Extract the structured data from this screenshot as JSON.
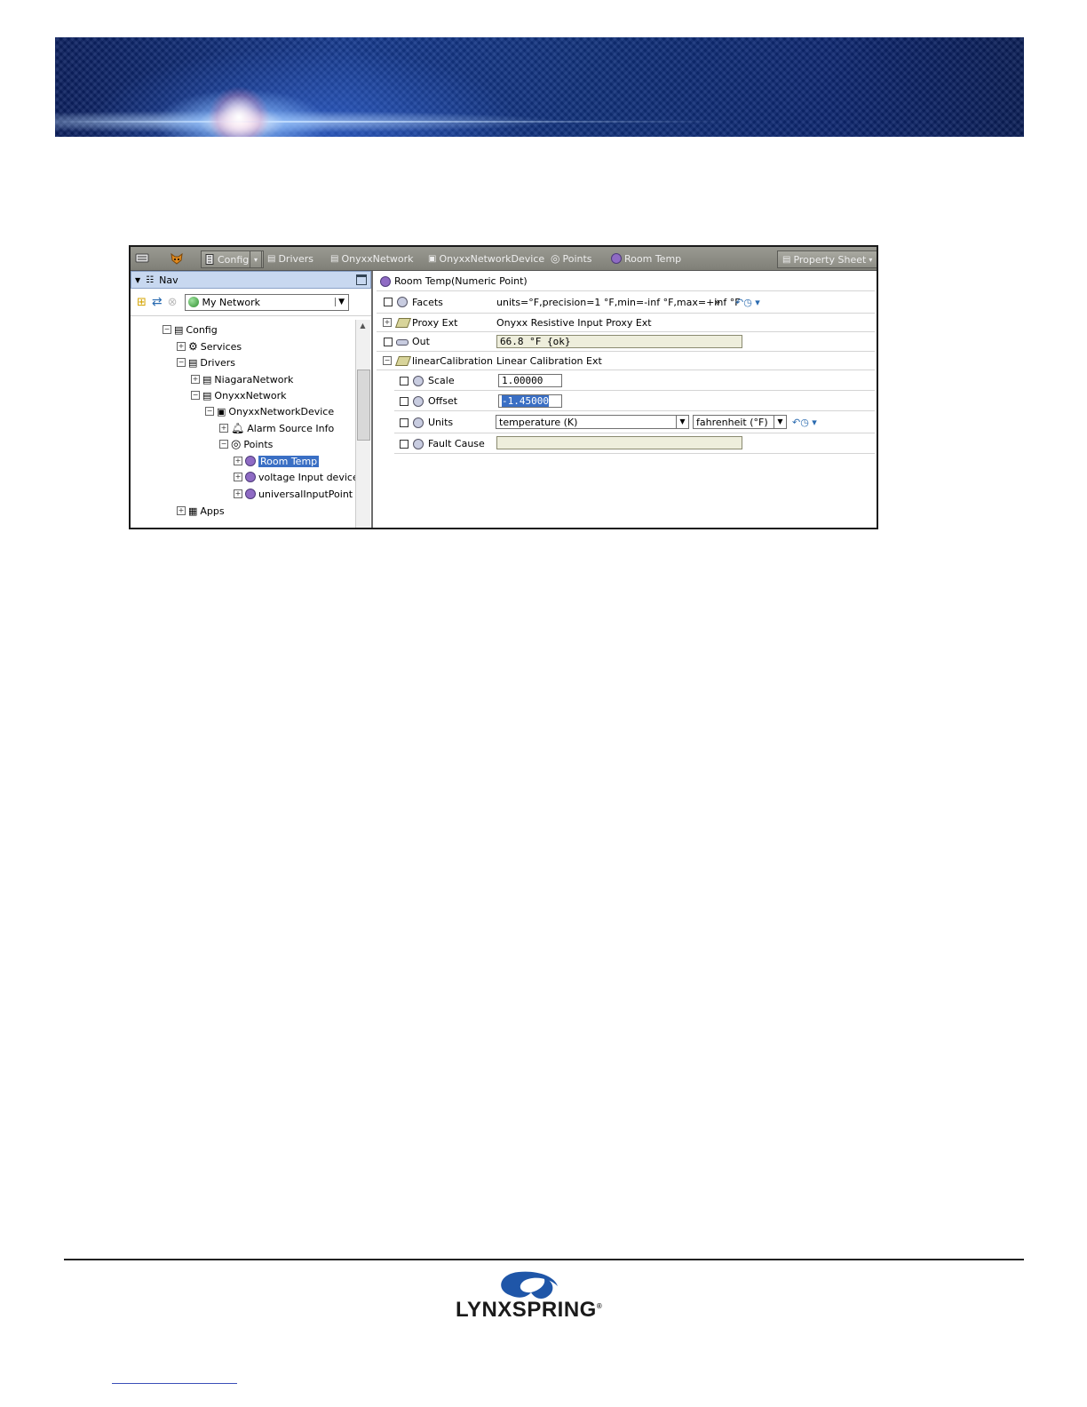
{
  "toolbar": {
    "config_label": "Config",
    "drivers_label": "Drivers",
    "network_label": "OnyxxNetwork",
    "device_label": "OnyxxNetworkDevice",
    "points_label": "Points",
    "point_label": "Room Temp",
    "view_label": "Property Sheet"
  },
  "nav": {
    "title": "Nav",
    "network_select": "My Network",
    "tree": [
      {
        "label": "Config",
        "toggle": "−"
      },
      {
        "label": "Services",
        "toggle": "+"
      },
      {
        "label": "Drivers",
        "toggle": "−"
      },
      {
        "label": "NiagaraNetwork",
        "toggle": "+"
      },
      {
        "label": "OnyxxNetwork",
        "toggle": "−"
      },
      {
        "label": "OnyxxNetworkDevice",
        "toggle": "−"
      },
      {
        "label": "Alarm Source Info",
        "toggle": "+"
      },
      {
        "label": "Points",
        "toggle": "−"
      },
      {
        "label": "Room Temp",
        "toggle": "+"
      },
      {
        "label": "voltage Input device",
        "toggle": "+"
      },
      {
        "label": "universalInputPoint",
        "toggle": "+"
      },
      {
        "label": "Apps",
        "toggle": "+"
      }
    ]
  },
  "sheet": {
    "title": "Room Temp",
    "title_type": "(Numeric Point)",
    "facets": {
      "label": "Facets",
      "value": "units=°F,precision=1 °F,min=-inf °F,max=+inf °F"
    },
    "proxy": {
      "label": "Proxy Ext",
      "value": "Onyxx Resistive Input Proxy Ext"
    },
    "out": {
      "label": "Out",
      "value": "66.8 °F {ok}"
    },
    "linear": {
      "label": "linearCalibration",
      "value": "Linear Calibration Ext"
    },
    "scale": {
      "label": "Scale",
      "value": "1.00000"
    },
    "offset": {
      "label": "Offset",
      "value": "-1.45000"
    },
    "units": {
      "label": "Units",
      "quantity": "temperature (K)",
      "unit": "fahrenheit (°F)"
    },
    "fault": {
      "label": "Fault Cause",
      "value": ""
    }
  },
  "footer": {
    "brand": "LYNXSPRING",
    "mark": "®"
  },
  "colors": {
    "selection": "#3a6fc4",
    "toolbar": "#8a8a82",
    "readonly_field": "#eeeedc",
    "point_icon": "#8f6bc4"
  }
}
